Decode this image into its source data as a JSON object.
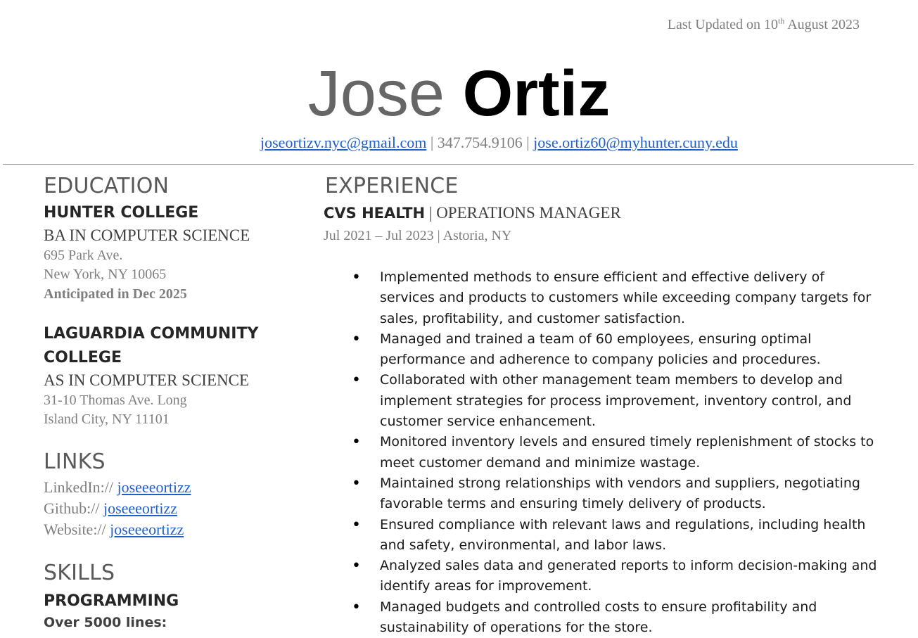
{
  "header": {
    "updated_prefix": "Last Updated on 10",
    "updated_sup": "th",
    "updated_suffix": " August 2023",
    "first_name": "Jose",
    "last_name": "Ortiz",
    "email_personal": "joseortizv.nyc@gmail.com",
    "separator": " | ",
    "phone": "347.754.9106",
    "email_school": "jose.ortiz60@myhunter.cuny.edu"
  },
  "education": {
    "title": "EDUCATION",
    "schools": [
      {
        "name": "HUNTER COLLEGE",
        "degree": "BA IN COMPUTER SCIENCE",
        "address_1": "695 Park Ave.",
        "address_2": "New York, NY 10065",
        "note": "Anticipated in Dec 2025"
      },
      {
        "name": "LAGUARDIA COMMUNITY COLLEGE",
        "degree": "AS IN COMPUTER SCIENCE",
        "address_1": "31-10 Thomas Ave. Long",
        "address_2": "Island City, NY 11101"
      }
    ]
  },
  "links": {
    "title": "LINKS",
    "items": [
      {
        "prefix": "LinkedIn:// ",
        "text": "joseeeortizz"
      },
      {
        "prefix": "Github:// ",
        "text": "joseeeortizz"
      },
      {
        "prefix": "Website:// ",
        "text": "joseeeortizz"
      }
    ]
  },
  "skills": {
    "title": "SKILLS",
    "heading": "PROGRAMMING",
    "sub": "Over 5000 lines:"
  },
  "experience": {
    "title": "EXPERIENCE",
    "jobs": [
      {
        "company": "CVS HEALTH",
        "sep": " | ",
        "role": "OPERATIONS MANAGER",
        "meta": "Jul 2021 – Jul 2023 | Astoria, NY",
        "bullets": [
          "Implemented methods to ensure efficient and effective delivery of services and products to customers while exceeding company targets for sales, profitability, and customer satisfaction.",
          "Managed and trained a team of 60 employees, ensuring optimal performance and adherence to company policies and procedures.",
          "Collaborated with other management team members to develop and implement strategies for process improvement, inventory control, and customer service enhancement.",
          "Monitored inventory levels and ensured timely replenishment of stocks to meet customer demand and minimize wastage.",
          "Maintained strong relationships with vendors and suppliers, negotiating favorable terms and ensuring timely delivery of products.",
          "Ensured compliance with relevant laws and regulations, including health and safety, environmental, and labor laws.",
          "Analyzed sales data and generated reports to inform decision-making and identify areas for improvement.",
          "Managed budgets and controlled costs to ensure profitability and sustainability of operations for the store."
        ]
      }
    ]
  }
}
